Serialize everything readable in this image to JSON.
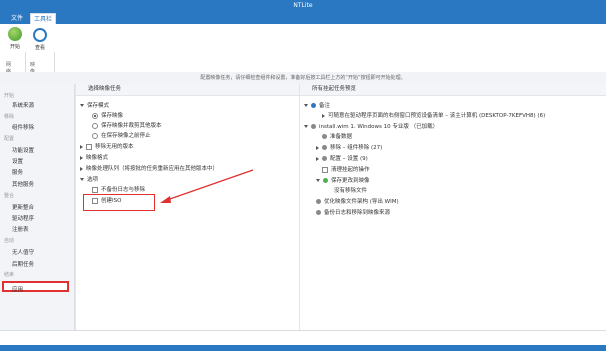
{
  "window": {
    "title": "NTLite"
  },
  "tabs": [
    {
      "label": "文件"
    },
    {
      "label": "工具栏"
    }
  ],
  "ribbon": {
    "start_label": "开始",
    "refresh_label": "查看",
    "group_left": "网络",
    "group_right": "映像任务"
  },
  "infobar": {
    "text": "配置映像任务，请仔细检查组件和设置，准备好后按工具栏上方的“开始”按钮即可开始处理。"
  },
  "sidebar": {
    "head_start": "开始",
    "item_source": "系统来源",
    "head_remove": "移除",
    "item_components": "组件移除",
    "head_configure": "配置",
    "item_features": "功能设置",
    "item_settings": "设置",
    "item_services": "服务",
    "item_other": "其他服务",
    "head_integrate": "整合",
    "item_updates": "更新整合",
    "item_drivers": "驱动程序",
    "item_registry": "注册表",
    "head_auto": "自动",
    "item_unattended": "无人值守",
    "item_post": "后期任务",
    "head_finish": "结束",
    "item_apply": "应用"
  },
  "left_panel": {
    "header": "选择映像任务",
    "save_mode": "保存模式",
    "save_image": "保存映像",
    "save_trim": "保存映像并裁剪其他版本",
    "save_stop": "在保存映像之前停止",
    "remove_unused": "移除无用的版本",
    "image_format": "映像格式",
    "process_queue": "映像处理队列（将按批的任务重新应用在其他版本中）",
    "options": "选项",
    "no_backup": "不备份日志与移除",
    "create_iso": "创建ISO"
  },
  "right_panel": {
    "header": "所有挂起任务预览",
    "notes": "备注",
    "notes_detail": "可随意在驱动程序页面的右侧窗口预览设备清单 – 该主计算机 (DESKTOP-7KEFVH8) (6)",
    "install": "install.wim 1. Windows 10 专业版 （已加载）",
    "prep_data": "准备数据",
    "components": "移除 – 组件移除 (27)",
    "settings": "配置 – 设置 (9)",
    "cleanup": "清理挂起的操作",
    "save_changes": "保存更改到映像",
    "no_removed": "没有移除文件",
    "optimize": "优化映像文件架构 (导出 WIM)",
    "backup": "备份日志和移除到映像来源"
  },
  "colors": {
    "accent": "#2b78c2",
    "highlight": "#e03030",
    "sidebar_bg": "#f2f4f7",
    "info_icon": "#2b78c2",
    "green_icon": "#4caf50"
  }
}
